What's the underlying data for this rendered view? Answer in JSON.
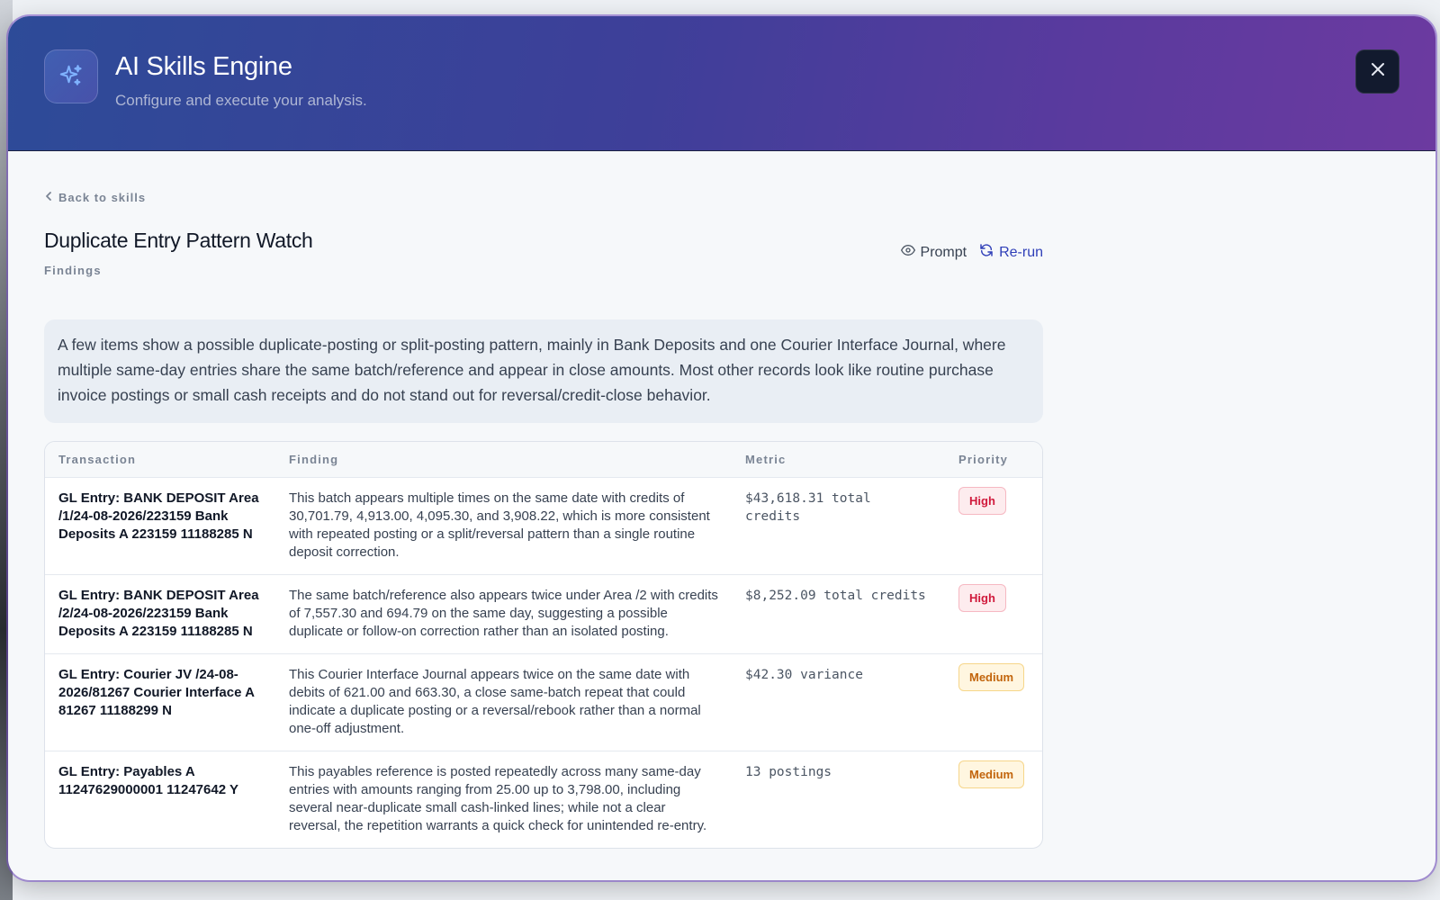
{
  "colors": {
    "header_start": "#2d4b98",
    "header_end": "#6c3aa0",
    "rerun": "#2f3fb8",
    "high": "#d01a3c",
    "medium": "#c2650c"
  },
  "header": {
    "icon": "sparkles-icon",
    "title": "AI Skills Engine",
    "subtitle": "Configure and execute your analysis.",
    "close_icon": "close-icon"
  },
  "nav": {
    "back_label": "Back to skills"
  },
  "skill": {
    "title": "Duplicate Entry Pattern Watch",
    "section_label": "Findings",
    "prompt_label": "Prompt",
    "rerun_label": "Re-run"
  },
  "summary": "A few items show a possible duplicate-posting or split-posting pattern, mainly in Bank Deposits and one Courier Interface Journal, where multiple same-day entries share the same batch/reference and appear in close amounts. Most other records look like routine purchase invoice postings or small cash receipts and do not stand out for reversal/credit-close behavior.",
  "table": {
    "columns": [
      "Transaction",
      "Finding",
      "Metric",
      "Priority"
    ],
    "rows": [
      {
        "transaction": "GL Entry: BANK DEPOSIT Area /1/24-08-2026/223159 Bank Deposits A 223159 11188285 N",
        "finding": "This batch appears multiple times on the same date with credits of 30,701.79, 4,913.00, 4,095.30, and 3,908.22, which is more consistent with repeated posting or a split/reversal pattern than a single routine deposit correction.",
        "metric": "$43,618.31 total credits",
        "priority": "High"
      },
      {
        "transaction": "GL Entry: BANK DEPOSIT Area /2/24-08-2026/223159 Bank Deposits A 223159 11188285 N",
        "finding": "The same batch/reference also appears twice under Area /2 with credits of 7,557.30 and 694.79 on the same day, suggesting a possible duplicate or follow-on correction rather than an isolated posting.",
        "metric": "$8,252.09 total credits",
        "priority": "High"
      },
      {
        "transaction": "GL Entry: Courier JV /24-08-2026/81267 Courier Interface A 81267 11188299 N",
        "finding": "This Courier Interface Journal appears twice on the same date with debits of 621.00 and 663.30, a close same-batch repeat that could indicate a duplicate posting or a reversal/rebook rather than a normal one-off adjustment.",
        "metric": "$42.30 variance",
        "priority": "Medium"
      },
      {
        "transaction": "GL Entry: Payables A 11247629000001 11247642 Y",
        "finding": "This payables reference is posted repeatedly across many same-day entries with amounts ranging from 25.00 up to 3,798.00, including several near-duplicate small cash-linked lines; while not a clear reversal, the repetition warrants a quick check for unintended re-entry.",
        "metric": "13 postings",
        "priority": "Medium"
      }
    ]
  }
}
